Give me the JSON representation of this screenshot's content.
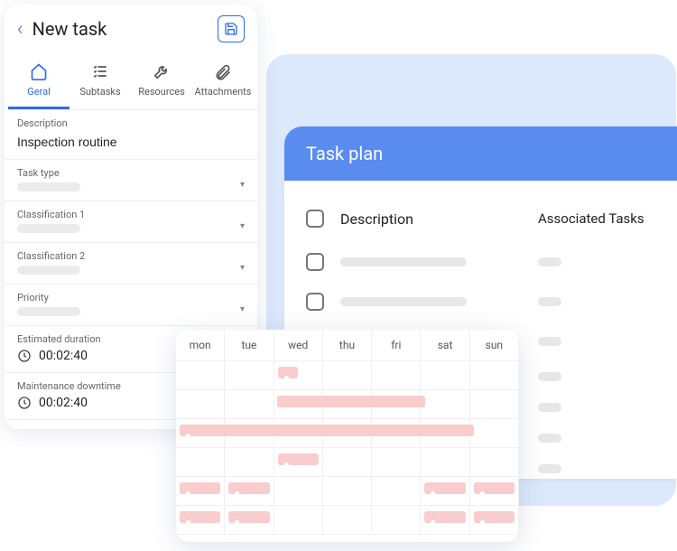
{
  "plan": {
    "title": "Task plan",
    "columns": {
      "desc": "Description",
      "assoc": "Associated Tasks"
    }
  },
  "task": {
    "back_glyph": "‹",
    "title": "New task",
    "tabs": {
      "general": "Geral",
      "subtasks": "Subtasks",
      "resources": "Resources",
      "attachments": "Attachments"
    },
    "fields": {
      "description_label": "Description",
      "description_value": "Inspection routine",
      "task_type_label": "Task type",
      "class1_label": "Classification 1",
      "class2_label": "Classification 2",
      "priority_label": "Priority",
      "est_dur_label": "Estimated duration",
      "est_dur_value": "00:02:40",
      "maint_dt_label": "Maintenance downtime",
      "maint_dt_value": "00:02:40"
    }
  },
  "calendar": {
    "days": {
      "mon": "mon",
      "tue": "tue",
      "wed": "wed",
      "thu": "thu",
      "fri": "fri",
      "sat": "sat",
      "sun": "sun"
    }
  }
}
